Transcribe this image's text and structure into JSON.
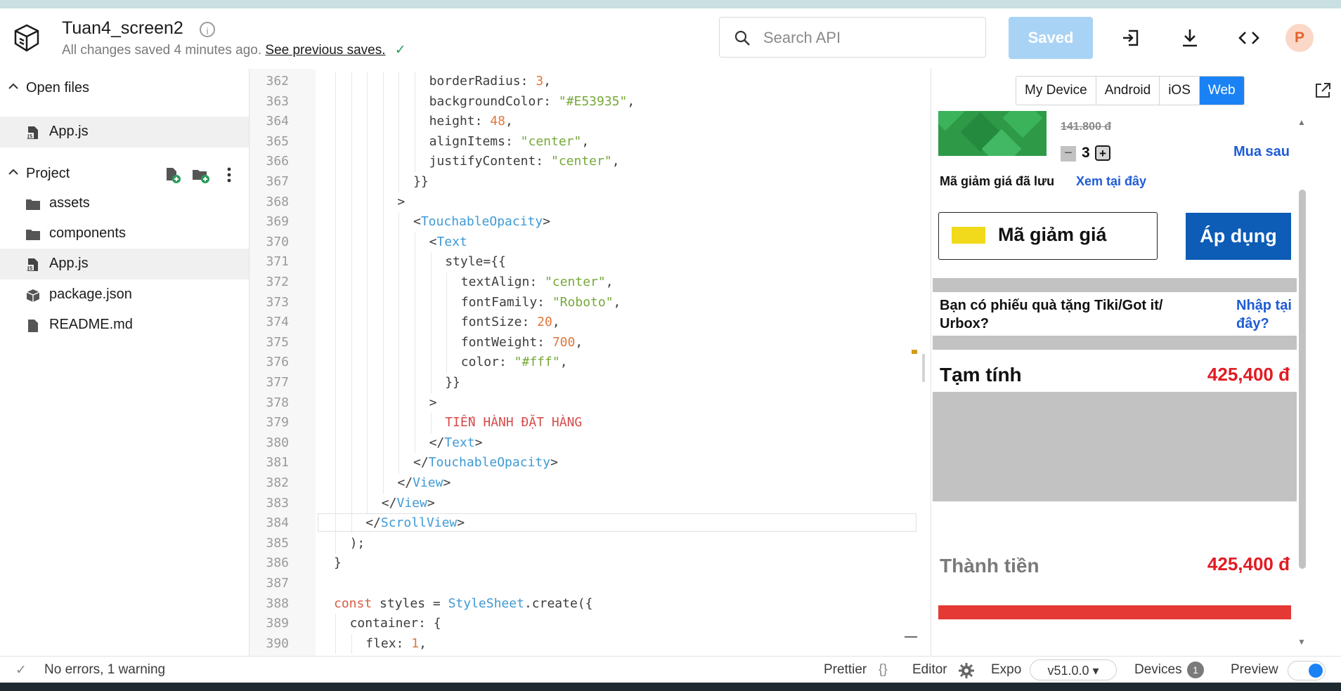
{
  "header": {
    "title": "Tuan4_screen2",
    "save_status": "All changes saved 4 minutes ago.",
    "see_previous": "See previous saves.",
    "search_placeholder": "Search API",
    "saved_label": "Saved",
    "avatar_letter": "P"
  },
  "sidebar": {
    "open_files_label": "Open files",
    "open_files": [
      {
        "name": "App.js"
      }
    ],
    "project_label": "Project",
    "project_items": [
      {
        "name": "assets",
        "icon": "folder-icon"
      },
      {
        "name": "components",
        "icon": "folder-icon"
      },
      {
        "name": "App.js",
        "icon": "js-file-icon"
      },
      {
        "name": "package.json",
        "icon": "package-icon"
      },
      {
        "name": "README.md",
        "icon": "document-icon"
      }
    ]
  },
  "editor": {
    "active_line": "384",
    "lines": [
      {
        "n": "362",
        "indent": 6,
        "tokens": [
          [
            "p",
            "borderRadius: "
          ],
          [
            "num",
            "3"
          ],
          [
            "p",
            ","
          ]
        ]
      },
      {
        "n": "363",
        "indent": 6,
        "tokens": [
          [
            "p",
            "backgroundColor: "
          ],
          [
            "str",
            "\"#E53935\""
          ],
          [
            "p",
            ","
          ]
        ]
      },
      {
        "n": "364",
        "indent": 6,
        "tokens": [
          [
            "p",
            "height: "
          ],
          [
            "num",
            "48"
          ],
          [
            "p",
            ","
          ]
        ]
      },
      {
        "n": "365",
        "indent": 6,
        "tokens": [
          [
            "p",
            "alignItems: "
          ],
          [
            "str",
            "\"center\""
          ],
          [
            "p",
            ","
          ]
        ]
      },
      {
        "n": "366",
        "indent": 6,
        "tokens": [
          [
            "p",
            "justifyContent: "
          ],
          [
            "str",
            "\"center\""
          ],
          [
            "p",
            ","
          ]
        ]
      },
      {
        "n": "367",
        "indent": 5,
        "tokens": [
          [
            "p",
            "}}"
          ]
        ]
      },
      {
        "n": "368",
        "indent": 4,
        "tokens": [
          [
            "p",
            ">"
          ]
        ]
      },
      {
        "n": "369",
        "indent": 5,
        "tokens": [
          [
            "p",
            "<"
          ],
          [
            "tag",
            "TouchableOpacity"
          ],
          [
            "p",
            ">"
          ]
        ]
      },
      {
        "n": "370",
        "indent": 6,
        "tokens": [
          [
            "p",
            "<"
          ],
          [
            "tag",
            "Text"
          ]
        ]
      },
      {
        "n": "371",
        "indent": 7,
        "tokens": [
          [
            "p",
            "style={{"
          ]
        ]
      },
      {
        "n": "372",
        "indent": 8,
        "tokens": [
          [
            "p",
            "textAlign: "
          ],
          [
            "str",
            "\"center\""
          ],
          [
            "p",
            ","
          ]
        ]
      },
      {
        "n": "373",
        "indent": 8,
        "tokens": [
          [
            "p",
            "fontFamily: "
          ],
          [
            "str",
            "\"Roboto\""
          ],
          [
            "p",
            ","
          ]
        ]
      },
      {
        "n": "374",
        "indent": 8,
        "tokens": [
          [
            "p",
            "fontSize: "
          ],
          [
            "num",
            "20"
          ],
          [
            "p",
            ","
          ]
        ]
      },
      {
        "n": "375",
        "indent": 8,
        "tokens": [
          [
            "p",
            "fontWeight: "
          ],
          [
            "num",
            "700"
          ],
          [
            "p",
            ","
          ]
        ]
      },
      {
        "n": "376",
        "indent": 8,
        "tokens": [
          [
            "p",
            "color: "
          ],
          [
            "str",
            "\"#fff\""
          ],
          [
            "p",
            ","
          ]
        ]
      },
      {
        "n": "377",
        "indent": 7,
        "tokens": [
          [
            "p",
            "}}"
          ]
        ]
      },
      {
        "n": "378",
        "indent": 6,
        "tokens": [
          [
            "p",
            ">"
          ]
        ]
      },
      {
        "n": "379",
        "indent": 7,
        "tokens": [
          [
            "txt",
            "TIẾN HÀNH ĐẶT HÀNG"
          ]
        ]
      },
      {
        "n": "380",
        "indent": 6,
        "tokens": [
          [
            "p",
            "</"
          ],
          [
            "tag",
            "Text"
          ],
          [
            "p",
            ">"
          ]
        ]
      },
      {
        "n": "381",
        "indent": 5,
        "tokens": [
          [
            "p",
            "</"
          ],
          [
            "tag",
            "TouchableOpacity"
          ],
          [
            "p",
            ">"
          ]
        ]
      },
      {
        "n": "382",
        "indent": 4,
        "tokens": [
          [
            "p",
            "</"
          ],
          [
            "tag",
            "View"
          ],
          [
            "p",
            ">"
          ]
        ]
      },
      {
        "n": "383",
        "indent": 3,
        "tokens": [
          [
            "p",
            "</"
          ],
          [
            "tag",
            "View"
          ],
          [
            "p",
            ">"
          ]
        ]
      },
      {
        "n": "384",
        "indent": 2,
        "tokens": [
          [
            "p",
            "</"
          ],
          [
            "tag",
            "ScrollView"
          ],
          [
            "p",
            ">"
          ]
        ]
      },
      {
        "n": "385",
        "indent": 1,
        "tokens": [
          [
            "p",
            ");"
          ]
        ]
      },
      {
        "n": "386",
        "indent": 0,
        "tokens": [
          [
            "p",
            "}"
          ]
        ]
      },
      {
        "n": "387",
        "indent": 0,
        "tokens": []
      },
      {
        "n": "388",
        "indent": 0,
        "tokens": [
          [
            "kw",
            "const"
          ],
          [
            "p",
            " styles = "
          ],
          [
            "tag",
            "StyleSheet"
          ],
          [
            "p",
            ".create({"
          ]
        ]
      },
      {
        "n": "389",
        "indent": 1,
        "tokens": [
          [
            "p",
            "container: {"
          ]
        ]
      },
      {
        "n": "390",
        "indent": 2,
        "tokens": [
          [
            "p",
            "flex: "
          ],
          [
            "num",
            "1"
          ],
          [
            "p",
            ","
          ]
        ]
      }
    ]
  },
  "preview": {
    "tabs": [
      "My Device",
      "Android",
      "iOS",
      "Web"
    ],
    "active_tab": "Web",
    "old_price": "141.800 đ",
    "qty": "3",
    "qty_minus": "−",
    "qty_plus": "+",
    "buy_later": "Mua sau",
    "coupon_saved": "Mã giảm giá đã lưu",
    "coupon_see": "Xem tại đây",
    "coupon_input": "Mã giảm giá",
    "apply": "Áp dụng",
    "gift_text": "Bạn có phiếu quà tặng Tiki/Got it/ Urbox?",
    "gift_link": "Nhập tại đây?",
    "subtotal_label": "Tạm tính",
    "subtotal_value": "425,400 đ",
    "total_label": "Thành tiền",
    "total_value": "425,400 đ"
  },
  "statusbar": {
    "problems": "No errors, 1 warning",
    "prettier": "Prettier",
    "editor": "Editor",
    "expo": "Expo",
    "version": "v51.0.0 ▾",
    "devices": "Devices",
    "devices_count": "1",
    "preview": "Preview"
  },
  "colors": {
    "accent": "#1a82f5",
    "saved_button": "#a9d3f5",
    "price_red": "#e21b23",
    "link_blue": "#1f5bd6",
    "apply_button": "#0d5cb6"
  }
}
